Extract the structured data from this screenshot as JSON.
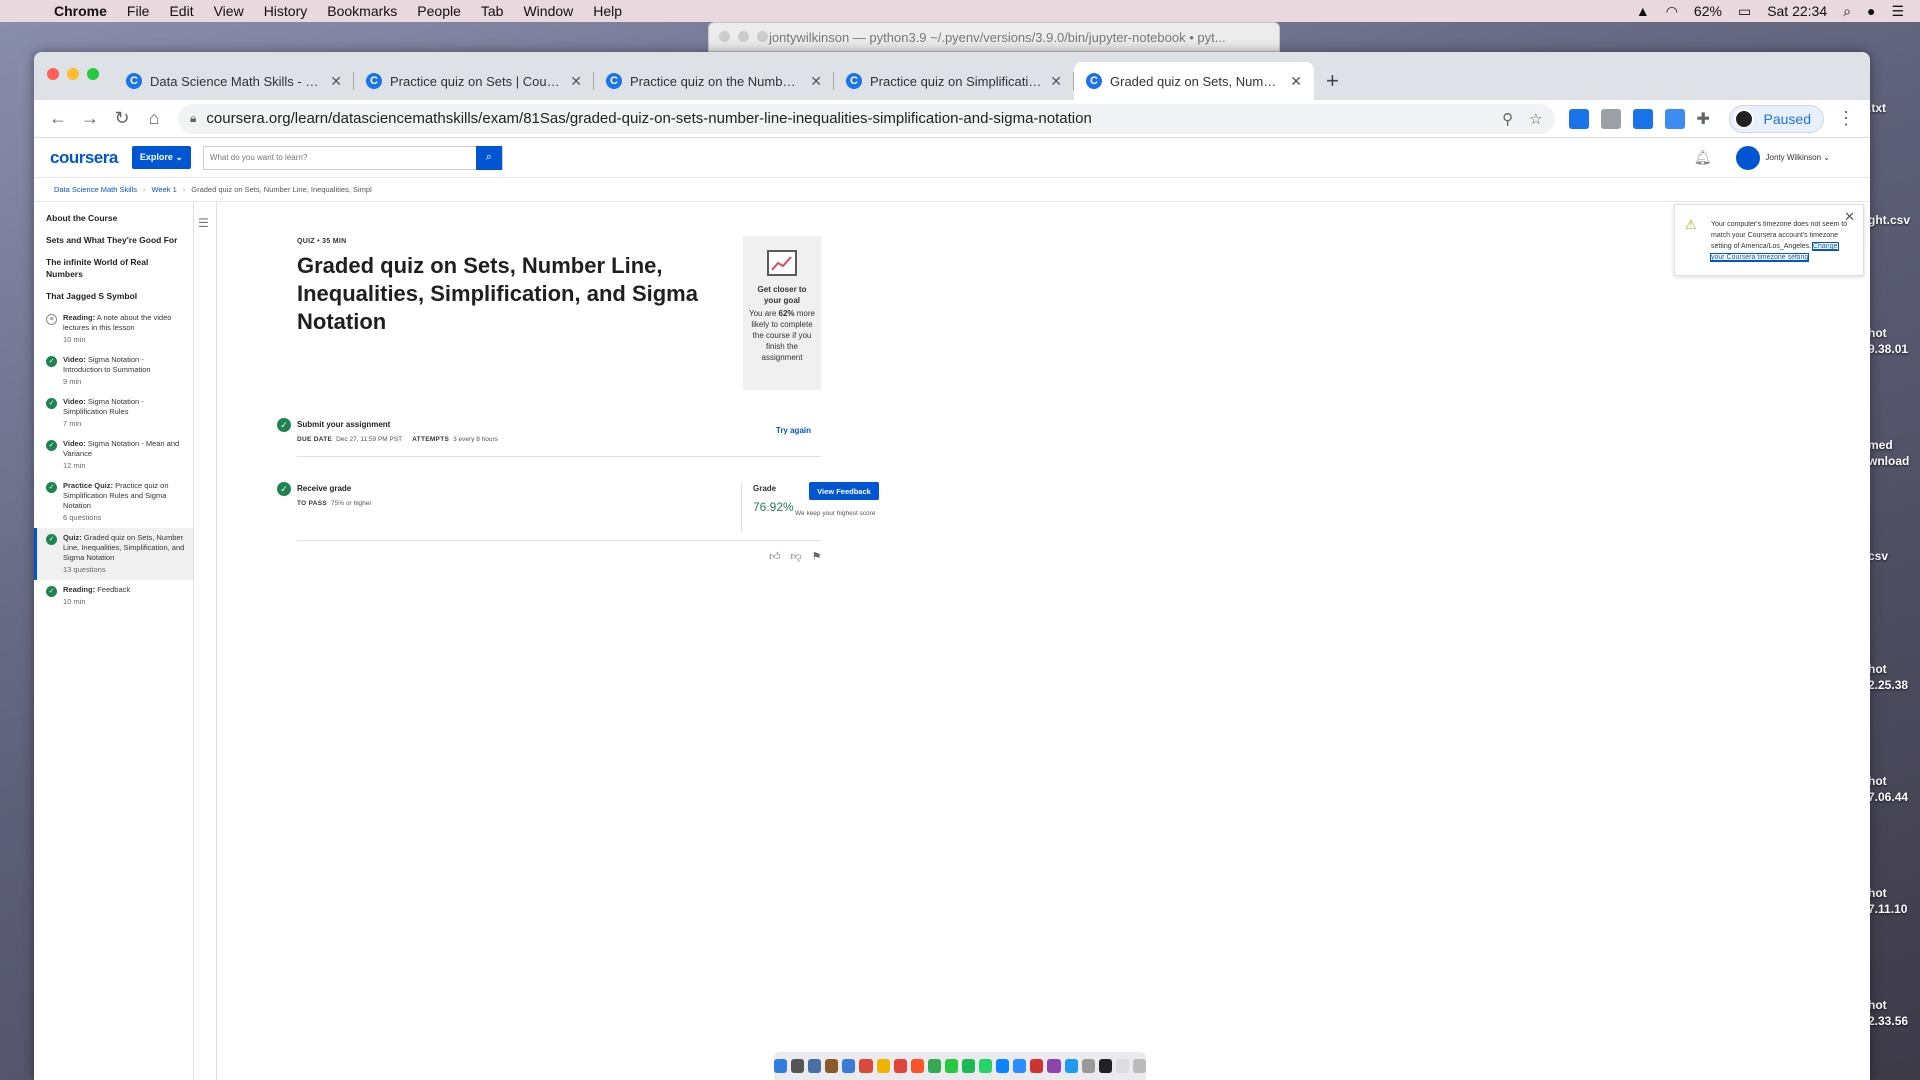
{
  "menubar": {
    "app": "Chrome",
    "items": [
      "File",
      "Edit",
      "View",
      "History",
      "Bookmarks",
      "People",
      "Tab",
      "Window",
      "Help"
    ],
    "battery": "62%",
    "clock": "Sat 22:34"
  },
  "terminal": {
    "title": "jontywilkinson — python3.9 ~/.pyenv/versions/3.9.0/bin/jupyter-notebook • pyt..."
  },
  "desktop_files": [
    {
      "label": ".txt"
    },
    {
      "label": "ght.csv"
    },
    {
      "label": "hot\n9.38.01"
    },
    {
      "label": "med\nwnload"
    },
    {
      "label": "csv"
    },
    {
      "label": "hot\n2.25.38"
    },
    {
      "label": "hot\n7.06.44"
    },
    {
      "label": "hot\n7.11.10"
    },
    {
      "label": "hot\n2.33.56"
    }
  ],
  "browser": {
    "tabs": [
      {
        "title": "Data Science Math Skills - Wel"
      },
      {
        "title": "Practice quiz on Sets | Coursera"
      },
      {
        "title": "Practice quiz on the Number Li"
      },
      {
        "title": "Practice quiz on Simplification"
      },
      {
        "title": "Graded quiz on Sets, Number L"
      }
    ],
    "url": "coursera.org/learn/datasciencemathskills/exam/81Sas/graded-quiz-on-sets-number-line-inequalities-simplification-and-sigma-notation",
    "profile_label": "Paused"
  },
  "coursera": {
    "logo": "coursera",
    "explore": "Explore ⌄",
    "search_placeholder": "What do you want to learn?",
    "user_name": "Jonty Wilkinson ⌄",
    "breadcrumb": [
      "Data Science Math Skills",
      "Week 1",
      "Graded quiz on Sets, Number Line, Inequalities, Simpl"
    ],
    "sidebar": {
      "sections": [
        "About the Course",
        "Sets and What They're Good For",
        "The infinite World of Real Numbers",
        "That Jagged S Symbol"
      ],
      "items": [
        {
          "type": "Reading:",
          "name": "A note about the video lectures in this lesson",
          "meta": "10 min",
          "done": false
        },
        {
          "type": "Video:",
          "name": "Sigma Notation - Introduction to Summation",
          "meta": "9 min",
          "done": true
        },
        {
          "type": "Video:",
          "name": "Sigma Notation - Simplification Rules",
          "meta": "7 min",
          "done": true
        },
        {
          "type": "Video:",
          "name": "Sigma Notation - Mean and Variance",
          "meta": "12 min",
          "done": true
        },
        {
          "type": "Practice Quiz:",
          "name": "Practice quiz on Simplification Rules and Sigma Notation",
          "meta": "6 questions",
          "done": true
        },
        {
          "type": "Quiz:",
          "name": "Graded quiz on Sets, Number Line, Inequalities, Simplification, and Sigma Notation",
          "meta": "13 questions",
          "done": true,
          "current": true
        },
        {
          "type": "Reading:",
          "name": "Feedback",
          "meta": "10 min",
          "done": true
        }
      ]
    },
    "quiz": {
      "meta": "QUIZ • 35 MIN",
      "title": "Graded quiz on Sets, Number Line, Inequalities, Simplification, and Sigma Notation",
      "goal": {
        "title": "Get closer to your goal",
        "text_pre": "You are ",
        "percent": "62%",
        "text_post": " more likely to complete the course if you finish the assignment"
      },
      "submit": {
        "title": "Submit your assignment",
        "due_label": "DUE DATE",
        "due_value": "Dec 27, 11:59 PM PST",
        "attempts_label": "ATTEMPTS",
        "attempts_value": "3 every 8 hours",
        "action": "Try again"
      },
      "receive": {
        "title": "Receive grade",
        "pass_label": "TO PASS",
        "pass_value": "75% or higher",
        "grade_label": "Grade",
        "grade_value": "76.92%",
        "button": "View Feedback",
        "note": "We keep your highest score"
      }
    },
    "alert": {
      "text": "Your computer's timezone does not seem to match your Coursera account's timezone setting of America/Los_Angeles.",
      "link": "Change your Coursera timezone setting"
    }
  }
}
